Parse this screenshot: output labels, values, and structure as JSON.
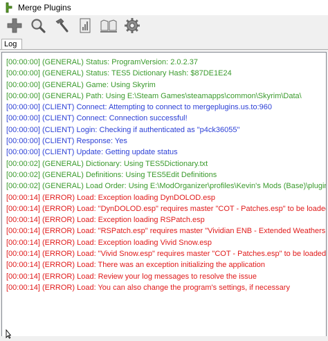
{
  "window": {
    "title": "Merge Plugins"
  },
  "toolbar": {
    "buttons": [
      {
        "icon": "plus-icon"
      },
      {
        "icon": "magnifier-icon"
      },
      {
        "icon": "hammer-icon"
      },
      {
        "icon": "report-icon"
      },
      {
        "icon": "books-icon"
      },
      {
        "icon": "gear-icon"
      }
    ]
  },
  "tabs": [
    {
      "label": "Log",
      "active": true
    }
  ],
  "colors": {
    "general": "#3a9a2c",
    "client": "#2b3fd6",
    "error": "#e01a1a"
  },
  "log": [
    {
      "level": "general",
      "text": "[00:00:00] (GENERAL) Status: ProgramVersion: 2.0.2.37"
    },
    {
      "level": "general",
      "text": "[00:00:00] (GENERAL) Status: TES5 Dictionary Hash: $87DE1E24"
    },
    {
      "level": "general",
      "text": "[00:00:00] (GENERAL) Game: Using Skyrim"
    },
    {
      "level": "general",
      "text": "[00:00:00] (GENERAL) Path: Using E:\\Steam Games\\steamapps\\common\\Skyrim\\Data\\"
    },
    {
      "level": "client",
      "text": "[00:00:00] (CLIENT) Connect: Attempting to connect to mergeplugins.us.to:960"
    },
    {
      "level": "client",
      "text": "[00:00:00] (CLIENT) Connect: Connection successful!"
    },
    {
      "level": "client",
      "text": "[00:00:00] (CLIENT) Login: Checking if authenticated as \"p4ck36055\""
    },
    {
      "level": "client",
      "text": "[00:00:00] (CLIENT) Response: Yes"
    },
    {
      "level": "client",
      "text": "[00:00:00] (CLIENT) Update: Getting update status"
    },
    {
      "level": "general",
      "text": "[00:00:02] (GENERAL) Dictionary: Using TES5Dictionary.txt"
    },
    {
      "level": "general",
      "text": "[00:00:02] (GENERAL) Definitions: Using TES5Edit Definitions"
    },
    {
      "level": "general",
      "text": "[00:00:02] (GENERAL) Load Order: Using E:\\ModOrganizer\\profiles\\Kevin's Mods (Base)\\plugins.txt"
    },
    {
      "level": "error",
      "text": "[00:00:14] (ERROR) Load: Exception loading DynDOLOD.esp"
    },
    {
      "level": "error",
      "text": "[00:00:14] (ERROR) Load: \"DynDOLOD.esp\" requires master \"COT - Patches.esp\" to be loaded before it."
    },
    {
      "level": "error",
      "text": "[00:00:14] (ERROR) Load: Exception loading RSPatch.esp"
    },
    {
      "level": "error",
      "text": "[00:00:14] (ERROR) Load: \"RSPatch.esp\" requires master \"Vividian ENB - Extended Weathers.esp\" to be loaded before it."
    },
    {
      "level": "error",
      "text": "[00:00:14] (ERROR) Load: Exception loading Vivid Snow.esp"
    },
    {
      "level": "error",
      "text": "[00:00:14] (ERROR) Load: \"Vivid Snow.esp\" requires master \"COT - Patches.esp\" to be loaded before it."
    },
    {
      "level": "error",
      "text": "[00:00:14] (ERROR) Load: There was an exception initializing the application"
    },
    {
      "level": "error",
      "text": "[00:00:14] (ERROR) Load: Review your log messages to resolve the issue"
    },
    {
      "level": "error",
      "text": "[00:00:14] (ERROR) Load: You can also change the program's settings, if necessary"
    }
  ]
}
